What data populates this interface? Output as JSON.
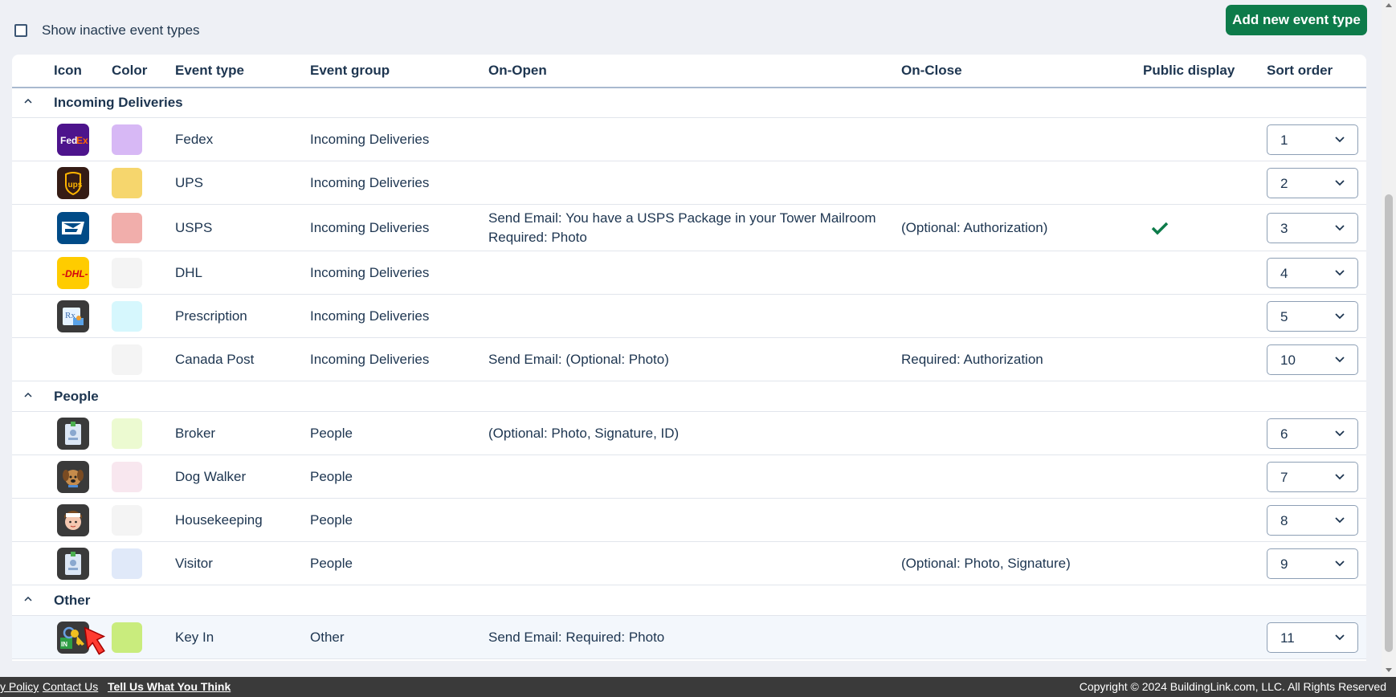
{
  "controls": {
    "show_inactive_label": "Show inactive event types",
    "add_button_label": "Add new event type"
  },
  "columns": [
    "Icon",
    "Color",
    "Event type",
    "Event group",
    "On-Open",
    "On-Close",
    "Public display",
    "Sort order"
  ],
  "groups": [
    {
      "label": "Incoming Deliveries",
      "rows": [
        {
          "icon": "fedex-icon",
          "color": "#d7b8f5",
          "event_type": "Fedex",
          "event_group": "Incoming Deliveries",
          "on_open": [
            "",
            ""
          ],
          "on_close": "",
          "public_display": false,
          "sort_order": "1"
        },
        {
          "icon": "ups-icon",
          "color": "#f6d66d",
          "event_type": "UPS",
          "event_group": "Incoming Deliveries",
          "on_open": [
            "",
            ""
          ],
          "on_close": "",
          "public_display": false,
          "sort_order": "2"
        },
        {
          "icon": "usps-icon",
          "color": "#f1aeab",
          "event_type": "USPS",
          "event_group": "Incoming Deliveries",
          "on_open": [
            "Send Email: You have a USPS Package in your Tower Mailroom",
            "Required: Photo"
          ],
          "on_close": "(Optional: Authorization)",
          "public_display": true,
          "sort_order": "3"
        },
        {
          "icon": "dhl-icon",
          "color": "#f4f4f4",
          "event_type": "DHL",
          "event_group": "Incoming Deliveries",
          "on_open": [
            "",
            ""
          ],
          "on_close": "",
          "public_display": false,
          "sort_order": "4"
        },
        {
          "icon": "prescription-icon",
          "color": "#d6f7fd",
          "event_type": "Prescription",
          "event_group": "Incoming Deliveries",
          "on_open": [
            "",
            ""
          ],
          "on_close": "",
          "public_display": false,
          "sort_order": "5"
        },
        {
          "icon": "",
          "color": "#f4f4f4",
          "event_type": "Canada Post",
          "event_group": "Incoming Deliveries",
          "on_open": [
            "Send Email: (Optional: Photo)",
            ""
          ],
          "on_close": "Required: Authorization",
          "public_display": false,
          "sort_order": "10"
        }
      ]
    },
    {
      "label": "People",
      "rows": [
        {
          "icon": "badge-icon",
          "color": "#ecfad1",
          "event_type": "Broker",
          "event_group": "People",
          "on_open": [
            "(Optional: Photo, Signature, ID)",
            ""
          ],
          "on_close": "",
          "public_display": false,
          "sort_order": "6"
        },
        {
          "icon": "dog-icon",
          "color": "#f8e7ef",
          "event_type": "Dog Walker",
          "event_group": "People",
          "on_open": [
            "",
            ""
          ],
          "on_close": "",
          "public_display": false,
          "sort_order": "7"
        },
        {
          "icon": "housekeeper-icon",
          "color": "#f4f4f4",
          "event_type": "Housekeeping",
          "event_group": "People",
          "on_open": [
            "",
            ""
          ],
          "on_close": "",
          "public_display": false,
          "sort_order": "8"
        },
        {
          "icon": "badge-icon",
          "color": "#e0e9f9",
          "event_type": "Visitor",
          "event_group": "People",
          "on_open": [
            "",
            ""
          ],
          "on_close": "(Optional: Photo, Signature)",
          "public_display": false,
          "sort_order": "9"
        }
      ]
    },
    {
      "label": "Other",
      "rows": [
        {
          "icon": "key-in-icon",
          "color": "#c9ec7d",
          "event_type": "Key In",
          "event_group": "Other",
          "on_open": [
            "Send Email: Required: Photo",
            ""
          ],
          "on_close": "",
          "public_display": false,
          "sort_order": "11"
        }
      ]
    }
  ],
  "footer": {
    "privacy": "y Policy",
    "contact": "Contact Us",
    "tell_us": "Tell Us What You Think",
    "copyright": "Copyright © 2024 BuildingLink.com, LLC.   All Rights Reserved"
  }
}
